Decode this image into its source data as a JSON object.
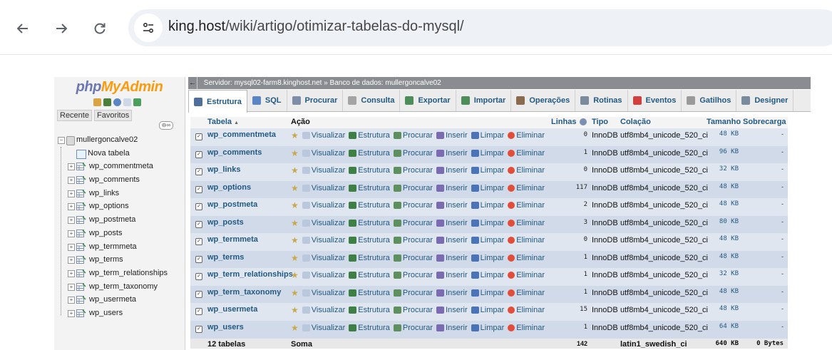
{
  "browser": {
    "url_host": "king.host",
    "url_path": "/wiki/artigo/otimizar-tabelas-do-mysql/"
  },
  "pma": {
    "logo_php": "php",
    "logo_myadmin": "MyAdmin",
    "nav_tabs": [
      "Recente",
      "Favoritos"
    ],
    "database": "mullergoncalve02",
    "new_table": "Nova tabela",
    "tree_tables": [
      "wp_commentmeta",
      "wp_comments",
      "wp_links",
      "wp_options",
      "wp_postmeta",
      "wp_posts",
      "wp_termmeta",
      "wp_terms",
      "wp_term_relationships",
      "wp_term_taxonomy",
      "wp_usermeta",
      "wp_users"
    ],
    "breadcrumb": {
      "server": "Servidor: mysql02-farm8.kinghost.net »",
      "database": "Banco de dados: mullergoncalve02"
    },
    "tabs": [
      "Estrutura",
      "SQL",
      "Procurar",
      "Consulta",
      "Exportar",
      "Importar",
      "Operações",
      "Rotinas",
      "Eventos",
      "Gatilhos",
      "Designer"
    ],
    "columns": {
      "table": "Tabela",
      "sort_arrow": "▲",
      "action": "Ação",
      "rows": "Linhas",
      "type": "Tipo",
      "collation": "Colação",
      "size": "Tamanho",
      "overhead": "Sobrecarga"
    },
    "actions": [
      "Visualizar",
      "Estrutura",
      "Procurar",
      "Inserir",
      "Limpar",
      "Eliminar"
    ],
    "tables": [
      {
        "name": "wp_commentmeta",
        "rows": "0",
        "type": "InnoDB",
        "collation": "utf8mb4_unicode_520_ci",
        "size": "48 KB",
        "overhead": "-"
      },
      {
        "name": "wp_comments",
        "rows": "1",
        "type": "InnoDB",
        "collation": "utf8mb4_unicode_520_ci",
        "size": "96 KB",
        "overhead": "-"
      },
      {
        "name": "wp_links",
        "rows": "0",
        "type": "InnoDB",
        "collation": "utf8mb4_unicode_520_ci",
        "size": "32 KB",
        "overhead": "-"
      },
      {
        "name": "wp_options",
        "rows": "117",
        "type": "InnoDB",
        "collation": "utf8mb4_unicode_520_ci",
        "size": "48 KB",
        "overhead": "-"
      },
      {
        "name": "wp_postmeta",
        "rows": "2",
        "type": "InnoDB",
        "collation": "utf8mb4_unicode_520_ci",
        "size": "48 KB",
        "overhead": "-"
      },
      {
        "name": "wp_posts",
        "rows": "3",
        "type": "InnoDB",
        "collation": "utf8mb4_unicode_520_ci",
        "size": "80 KB",
        "overhead": "-"
      },
      {
        "name": "wp_termmeta",
        "rows": "0",
        "type": "InnoDB",
        "collation": "utf8mb4_unicode_520_ci",
        "size": "48 KB",
        "overhead": "-"
      },
      {
        "name": "wp_terms",
        "rows": "1",
        "type": "InnoDB",
        "collation": "utf8mb4_unicode_520_ci",
        "size": "48 KB",
        "overhead": "-"
      },
      {
        "name": "wp_term_relationships",
        "rows": "1",
        "type": "InnoDB",
        "collation": "utf8mb4_unicode_520_ci",
        "size": "32 KB",
        "overhead": "-"
      },
      {
        "name": "wp_term_taxonomy",
        "rows": "1",
        "type": "InnoDB",
        "collation": "utf8mb4_unicode_520_ci",
        "size": "48 KB",
        "overhead": "-"
      },
      {
        "name": "wp_usermeta",
        "rows": "15",
        "type": "InnoDB",
        "collation": "utf8mb4_unicode_520_ci",
        "size": "48 KB",
        "overhead": "-"
      },
      {
        "name": "wp_users",
        "rows": "1",
        "type": "InnoDB",
        "collation": "utf8mb4_unicode_520_ci",
        "size": "64 KB",
        "overhead": "-"
      }
    ],
    "footer": {
      "count": "12 tabelas",
      "sum": "Soma",
      "rows": "142",
      "collation": "latin1_swedish_ci",
      "size": "640 KB",
      "overhead": "0 Bytes"
    }
  }
}
